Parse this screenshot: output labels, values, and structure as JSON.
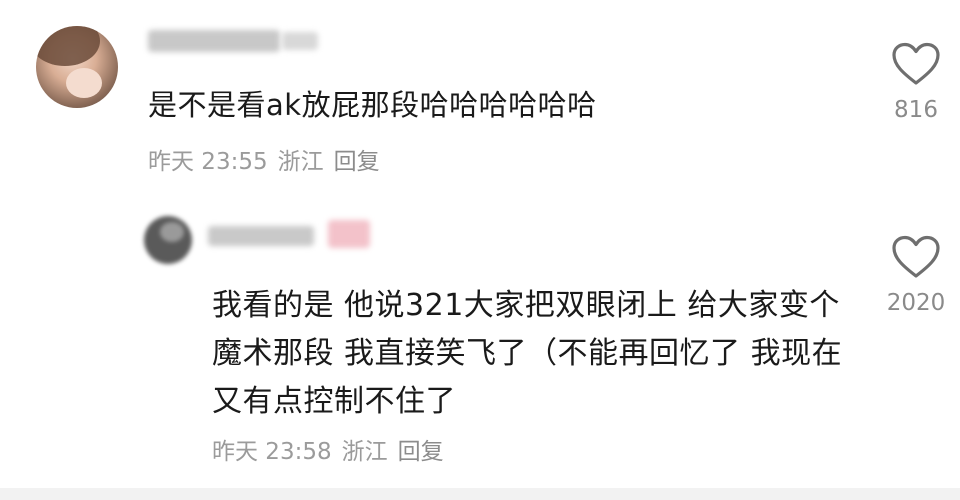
{
  "comment": {
    "text": "是不是看ak放屁那段哈哈哈哈哈哈",
    "time": "昨天 23:55",
    "location": "浙江",
    "reply_label": "回复",
    "likes": "816"
  },
  "reply": {
    "text": "我看的是 他说321大家把双眼闭上 给大家变个魔术那段 我直接笑飞了（不能再回忆了 我现在又有点控制不住了",
    "time": "昨天 23:58",
    "location": "浙江",
    "reply_label": "回复",
    "likes": "2020"
  },
  "icons": {
    "like": "heart-outline-icon"
  },
  "colors": {
    "text": "#1a1a1a",
    "meta": "#9b9b9b",
    "icon": "#6f6f6f"
  }
}
